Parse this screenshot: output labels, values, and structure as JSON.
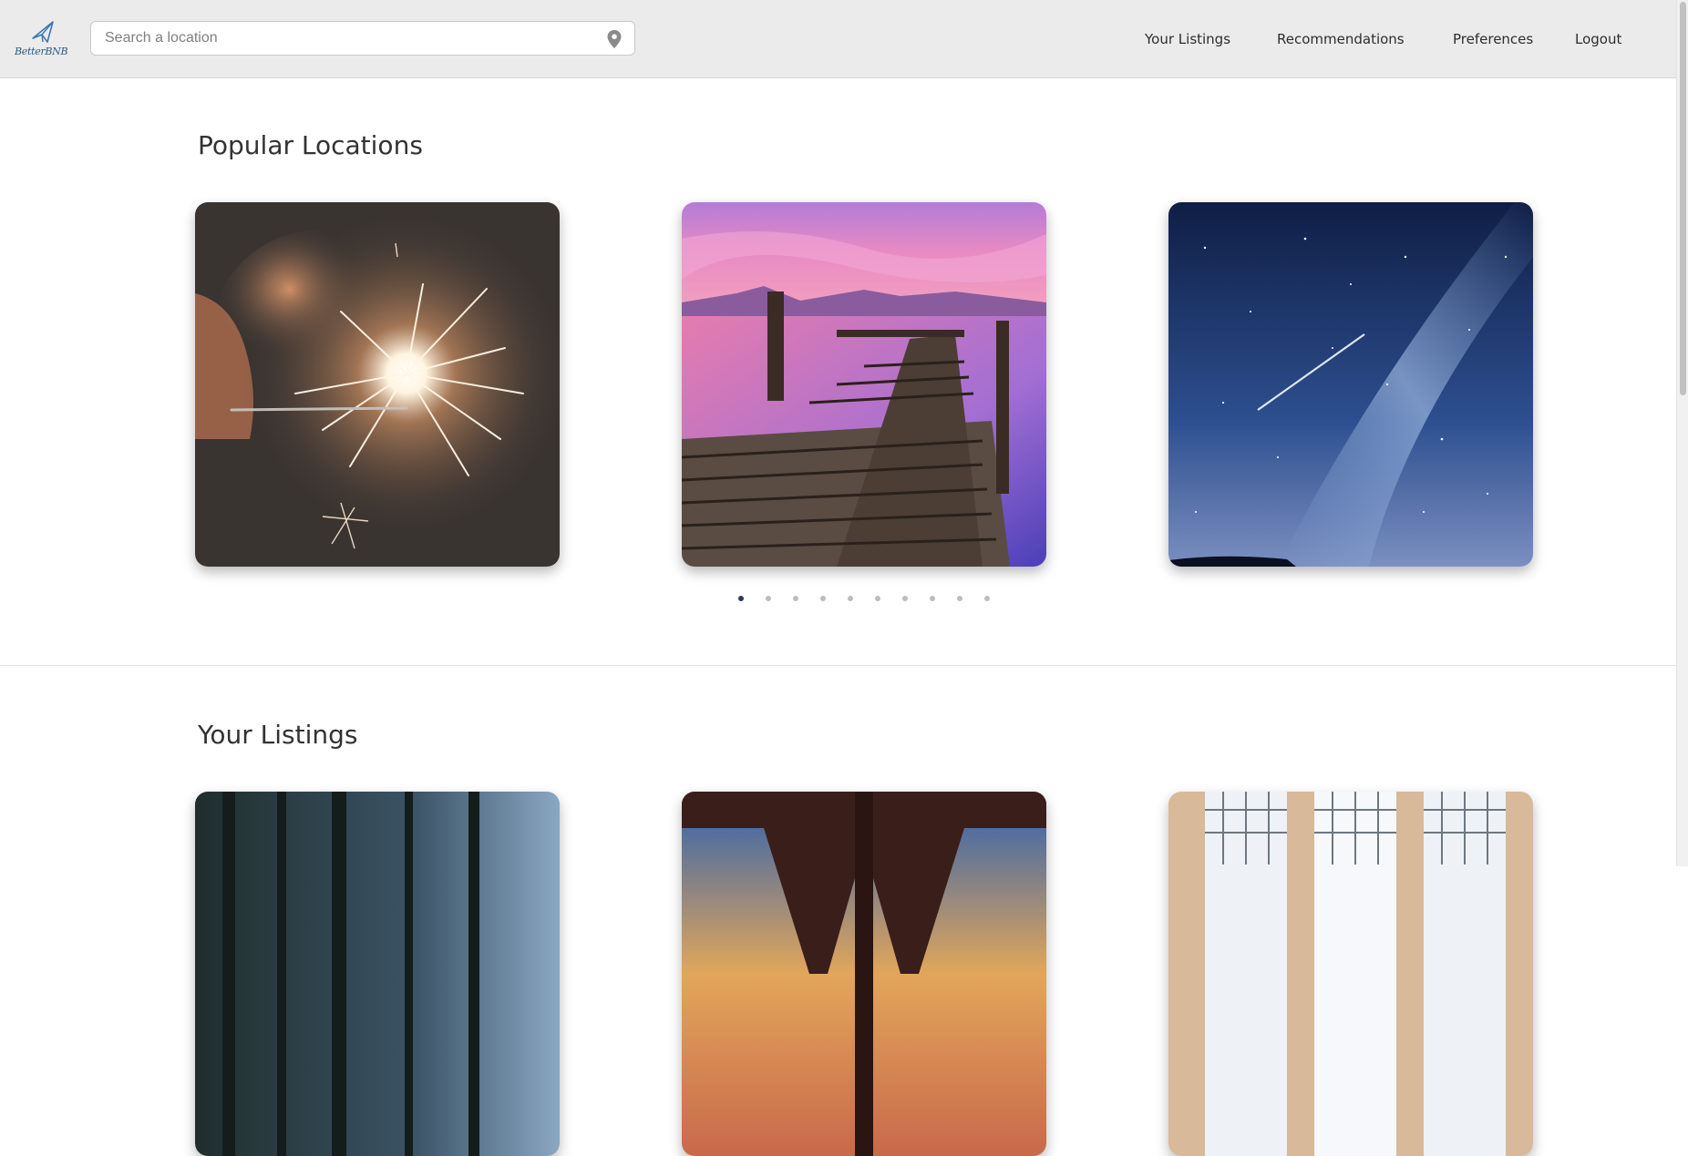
{
  "header": {
    "logo_text": "BetterBNB",
    "search": {
      "placeholder": "Search a location",
      "value": ""
    },
    "nav": [
      {
        "label": "Your Listings"
      },
      {
        "label": "Recommendations"
      },
      {
        "label": "Preferences"
      },
      {
        "label": "Logout"
      }
    ]
  },
  "popular": {
    "title": "Popular Locations",
    "cards": [
      {
        "image": "sparkler-photo"
      },
      {
        "image": "pier-sunset-photo"
      },
      {
        "image": "milky-way-photo"
      }
    ],
    "carousel": {
      "total_pages": 10,
      "active_page": 1
    }
  },
  "listings": {
    "title": "Your Listings",
    "cards": [
      {
        "image": "forest-photo"
      },
      {
        "image": "bridge-sunset-photo"
      },
      {
        "image": "building-window-photo"
      }
    ]
  },
  "colors": {
    "header_bg": "#ebebeb",
    "logo_blue": "#2b5d8a",
    "active_dot": "#2e3a55",
    "inactive_dot": "#bdbdbd"
  }
}
